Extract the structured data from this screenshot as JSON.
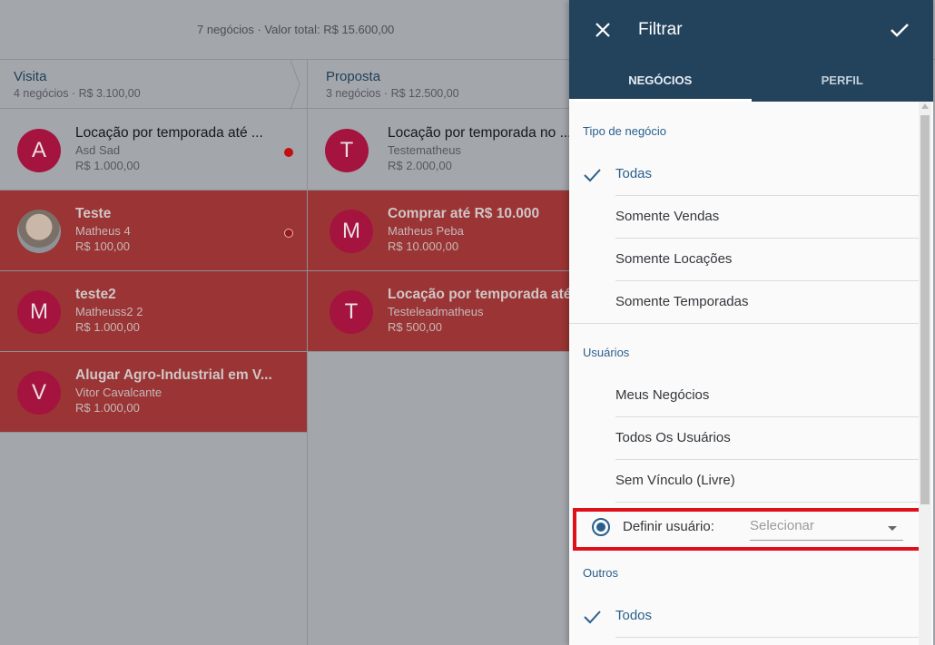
{
  "summary": "7 negócios · Valor total: R$ 15.600,00",
  "stages": [
    {
      "title": "Visita",
      "subtitle": "4 negócios · R$ 3.100,00"
    },
    {
      "title": "Proposta",
      "subtitle": "3 negócios · R$ 12.500,00"
    }
  ],
  "column1": [
    {
      "initial": "A",
      "title": "Locação por temporada até ...",
      "person": "Asd Sad",
      "value": "R$ 1.000,00"
    },
    {
      "initial": "",
      "title": "Teste",
      "person": "Matheus 4",
      "value": "R$ 100,00"
    },
    {
      "initial": "M",
      "title": "teste2",
      "person": "Matheuss2 2",
      "value": "R$ 1.000,00"
    },
    {
      "initial": "V",
      "title": "Alugar Agro-Industrial em V...",
      "person": "Vitor Cavalcante",
      "value": "R$ 1.000,00"
    }
  ],
  "column2": [
    {
      "initial": "T",
      "title": "Locação por temporada no ...",
      "person": "Testematheus",
      "value": "R$ 2.000,00"
    },
    {
      "initial": "M",
      "title": "Comprar até R$ 10.000",
      "person": "Matheus Peba",
      "value": "R$ 10.000,00"
    },
    {
      "initial": "T",
      "title": "Locação por temporada até ...",
      "person": "Testeleadmatheus",
      "value": "R$ 500,00"
    }
  ],
  "panel": {
    "title": "Filtrar",
    "tabs": [
      "NEGÓCIOS",
      "PERFIL"
    ],
    "sections": {
      "tipo": "Tipo de negócio",
      "usuarios": "Usuários",
      "outros": "Outros"
    },
    "tipo_options": [
      "Todas",
      "Somente Vendas",
      "Somente Locações",
      "Somente Temporadas"
    ],
    "usuarios_options": [
      "Meus Negócios",
      "Todos Os Usuários",
      "Sem Vínculo (Livre)"
    ],
    "define_user_label": "Definir usuário:",
    "define_user_placeholder": "Selecionar",
    "outros_options": [
      "Todos"
    ]
  },
  "colors": {
    "accent": "#23435c",
    "link": "#2a5f8c",
    "highlight": "#e0101b",
    "avatar": "#a5133f",
    "card_red": "#9b3434"
  }
}
